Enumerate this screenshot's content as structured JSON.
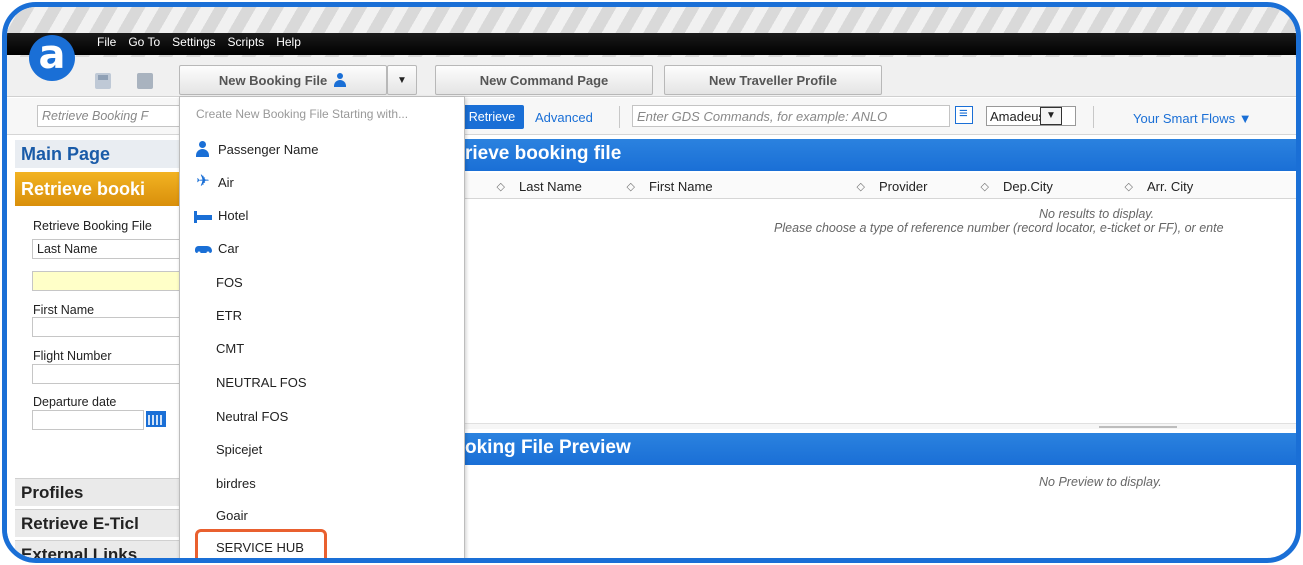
{
  "app": {
    "logo_letter": "a"
  },
  "menu": [
    "File",
    "Go To",
    "Settings",
    "Scripts",
    "Help"
  ],
  "toolbar": {
    "new_booking_label": "New Booking File",
    "dropdown_arrow": "▼",
    "new_command_label": "New Command Page",
    "new_traveller_label": "New Traveller Profile"
  },
  "search": {
    "retrieve_placeholder": "Retrieve Booking F",
    "retrieve_button": "Retrieve",
    "advanced_link": "Advanced",
    "gds_placeholder": "Enter GDS Commands, for example: ANLO",
    "provider_value": "Amadeus",
    "smart_flows": "Your Smart Flows ▼"
  },
  "left_panel": {
    "main_page": "Main Page",
    "retrieve_section": "Retrieve booki",
    "retrieve_booking_file": "Retrieve Booking File",
    "last_name_option": "Last Name",
    "first_name_label": "First Name",
    "flight_number_label": "Flight Number",
    "departure_date_label": "Departure date",
    "profiles": "Profiles",
    "retrieve_eticket": "Retrieve E-Ticl",
    "external_links": "External Links"
  },
  "main": {
    "retrieve_header": "rieve booking file",
    "columns": [
      "Last Name",
      "First Name",
      "Provider",
      "Dep.City",
      "Arr. City"
    ],
    "no_results": "No results to display.",
    "no_results_hint": "Please choose a type of reference number (record locator, e-ticket or FF), or ente",
    "preview_header": "oking File Preview",
    "no_preview": "No Preview to display."
  },
  "dropdown": {
    "heading": "Create New Booking File Starting with...",
    "items": [
      {
        "label": "Passenger Name",
        "icon": "person-icon"
      },
      {
        "label": "Air",
        "icon": "airplane-icon"
      },
      {
        "label": "Hotel",
        "icon": "bed-icon"
      },
      {
        "label": "Car",
        "icon": "car-icon"
      },
      {
        "label": "FOS"
      },
      {
        "label": "ETR"
      },
      {
        "label": "CMT"
      },
      {
        "label": "NEUTRAL FOS"
      },
      {
        "label": "Neutral FOS"
      },
      {
        "label": "Spicejet"
      },
      {
        "label": "birdres"
      },
      {
        "label": "Goair"
      },
      {
        "label": "SERVICE HUB"
      }
    ]
  },
  "colors": {
    "accent": "#1a6fd6",
    "retrieve_orange": "#e9a21a",
    "highlight": "#e9602f"
  }
}
